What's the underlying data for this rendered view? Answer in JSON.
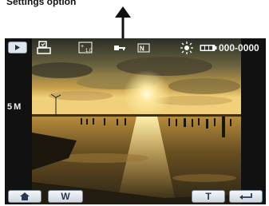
{
  "caption": "Settings option",
  "status_bar": {
    "mode": "playback",
    "counter": "000-0000",
    "icons": [
      "play-icon",
      "print-icon",
      "exposure-icon",
      "protect-key-icon",
      "night-mode-icon",
      "white-balance-sun-icon",
      "battery-icon"
    ]
  },
  "resolution": "5 M",
  "softkeys": {
    "home": "home-icon",
    "wide": "W",
    "tele": "T",
    "back": "return-icon"
  }
}
